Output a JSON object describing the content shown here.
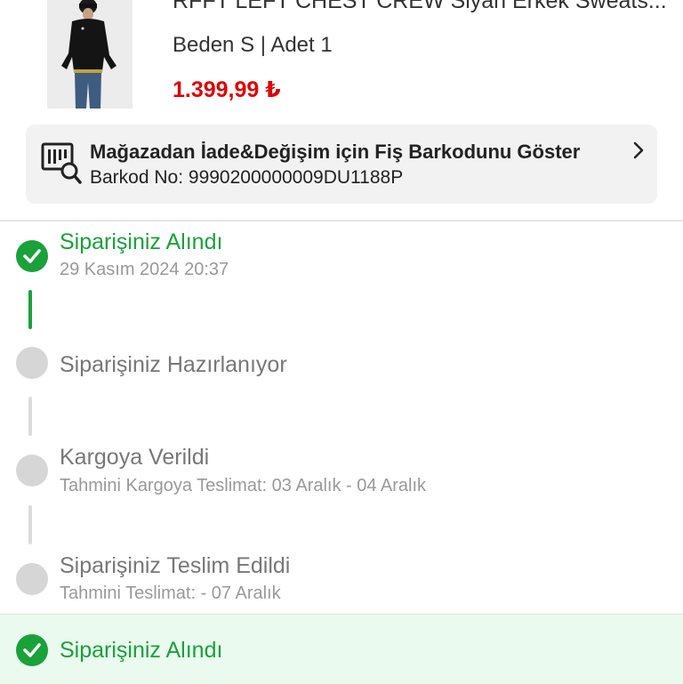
{
  "product": {
    "title": "RFFT LEFT CHEST CREW Siyah Erkek Sweats...",
    "meta": "Beden S | Adet 1",
    "price": "1.399,99 ₺"
  },
  "barcode": {
    "title": "Mağazadan İade&Değişim için Fiş Barkodunu Göster",
    "number": "Barkod No: 9990200000009DU1188P"
  },
  "steps": [
    {
      "title": "Siparişiniz Alındı",
      "subtitle": "29 Kasım 2024 20:37",
      "status": "done"
    },
    {
      "title": "Siparişiniz Hazırlanıyor",
      "subtitle": "",
      "status": "pending"
    },
    {
      "title": "Kargoya Verildi",
      "subtitle": "Tahmini Kargoya Teslimat: 03 Aralık - 04 Aralık",
      "status": "pending"
    },
    {
      "title": "Siparişiniz Teslim Edildi",
      "subtitle": "Tahmini Teslimat: - 07 Aralık",
      "status": "pending"
    }
  ],
  "status_bar": {
    "title": "Siparişiniz Alındı"
  },
  "colors": {
    "accent_green": "#1aa13a",
    "price_red": "#e00000",
    "pending_gray": "#d6d6d6",
    "status_bar_bg": "#eafaef"
  }
}
